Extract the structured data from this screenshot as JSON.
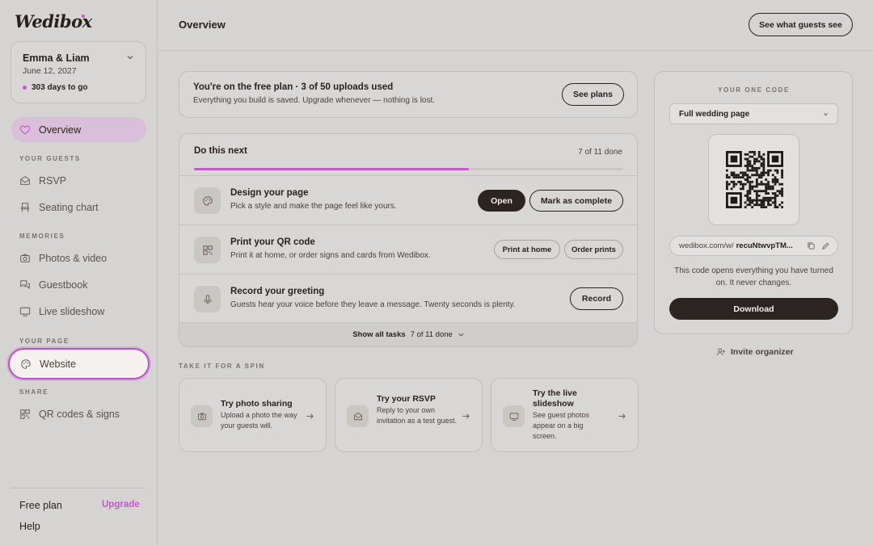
{
  "app": {
    "logo": "Wedibox"
  },
  "couple": {
    "name": "Emma & Liam",
    "date": "June 12, 2027",
    "days_left": "303 days to go"
  },
  "nav": {
    "overview": "Overview",
    "section_guests": "YOUR GUESTS",
    "rsvp": "RSVP",
    "seating": "Seating chart",
    "section_memories": "MEMORIES",
    "photos": "Photos & video",
    "guestbook": "Guestbook",
    "slideshow": "Live slideshow",
    "section_page": "YOUR PAGE",
    "website": "Website",
    "section_share": "SHARE",
    "qr": "QR codes & signs"
  },
  "footer": {
    "plan": "Free plan",
    "upgrade": "Upgrade",
    "help": "Help"
  },
  "header": {
    "title": "Overview",
    "preview_button": "See what guests see"
  },
  "plan_banner": {
    "title": "You're on the free plan · 3 of 50 uploads used",
    "subtitle": "Everything you build is saved. Upgrade whenever — nothing is lost.",
    "button": "See plans"
  },
  "tasks": {
    "heading": "Do this next",
    "count": "7 of 11 done",
    "progress": 0.64,
    "items": [
      {
        "title": "Design your page",
        "desc": "Pick a style and make the page feel like yours.",
        "primary": "Open",
        "secondary": "Mark as complete"
      },
      {
        "title": "Print your QR code",
        "desc": "Print it at home, or order signs and cards from Wedibox.",
        "primary": "Print at home",
        "secondary": "Order prints"
      },
      {
        "title": "Record your greeting",
        "desc": "Guests hear your voice before they leave a message. Twenty seconds is plenty.",
        "primary": "Record"
      }
    ],
    "show_all": "Show all tasks",
    "show_all_count": "7 of 11 done"
  },
  "spin": {
    "label": "TAKE IT FOR A SPIN",
    "cards": [
      {
        "title": "Try photo sharing",
        "desc": "Upload a photo the way your guests will."
      },
      {
        "title": "Try your RSVP",
        "desc": "Reply to your own invitation as a test guest."
      },
      {
        "title": "Try the live slideshow",
        "desc": "See guest photos appear on a big screen."
      }
    ]
  },
  "code_panel": {
    "label": "YOUR ONE CODE",
    "select_value": "Full wedding page",
    "url_prefix": "wedibox.com/w/",
    "url_code": "recuNtwvpTM...",
    "note": "This code opens everything you have turned on. It never changes.",
    "download": "Download",
    "invite": "Invite organizer"
  },
  "colors": {
    "accent": "#c05cc6",
    "dark": "#2c2420",
    "background": "#d6d4d2"
  }
}
